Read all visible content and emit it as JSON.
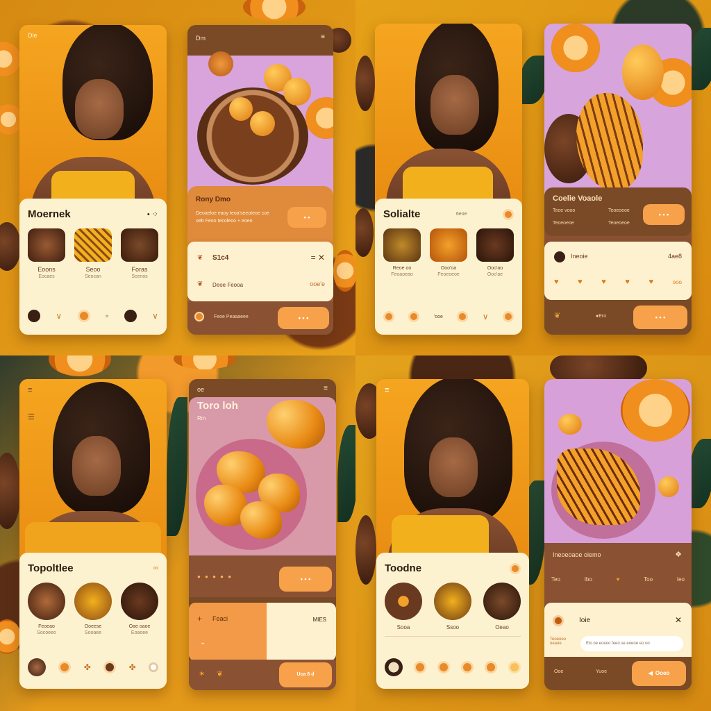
{
  "q1": {
    "profile": {
      "header": "Dle",
      "name": "Moernek",
      "actions": "• ⁘",
      "items": [
        {
          "label": "Eoons",
          "sub": "Eocaes"
        },
        {
          "label": "Seoo",
          "sub": "Seocan"
        },
        {
          "label": "Foras",
          "sub": "Scenos"
        }
      ]
    },
    "food": {
      "header": "Dm",
      "title": "Rony Dmo",
      "desc": "Deoaeloe eaoy teoa'seeoteoe coe oeb Feoo tecoleoo + eoeo",
      "row1": "S1c4",
      "row1_icons": "= ✕",
      "row2_label": "Deoe Feooa",
      "row2_value": "ooe'e",
      "footer": "Feoe Peaaaeee"
    }
  },
  "q2": {
    "profile": {
      "name": "Solialte",
      "tag": "6eoe",
      "items": [
        {
          "label": "Reoe oo",
          "sub": "Feoaoeao"
        },
        {
          "label": "Ooo'oa",
          "sub": "Feoeoeoe"
        },
        {
          "label": "Ooo'ao",
          "sub": "Ooo'ae"
        }
      ],
      "meta": "'ooe"
    },
    "food": {
      "title": "Coelie Voaole",
      "row_a": "Teoe vooo",
      "row_b": "Teoeoeoe",
      "row_c": "Teoeoeoe",
      "row_d": "Teoeoeoe",
      "bar_name": "Ineoie",
      "bar_value": "4ae8",
      "bar_tail": "ooo",
      "footer": "●Ero"
    }
  },
  "q3": {
    "profile": {
      "name": "Topoltlee",
      "items": [
        {
          "label": "Feoeao",
          "sub": "Socoeeo"
        },
        {
          "label": "Ooeese",
          "sub": "Sooaee"
        },
        {
          "label": "Oae oaoe",
          "sub": "Eoaoee"
        }
      ]
    },
    "food": {
      "header": "oe",
      "title": "Toro loh",
      "sub": "Rm",
      "bar_left": "Feaci",
      "bar_right": "MIES",
      "footer_btn": "Uca 6 d"
    }
  },
  "q4": {
    "profile": {
      "name": "Toodne",
      "items": [
        {
          "label": "Sooa"
        },
        {
          "label": "Ssoo"
        },
        {
          "label": "Oeao"
        }
      ]
    },
    "food": {
      "title": "Ineoeoaoe oiemo",
      "stats": [
        "Teo",
        "Ibo",
        "Too",
        "Ieo"
      ],
      "card_title": "Ioie",
      "card_note": "Teoeoeo oeaoe",
      "input": "Eio oe eoeoo feeo se eoeoe eo oo",
      "nav": [
        "Ooe",
        "Yuoe",
        "Ooeo"
      ]
    }
  }
}
